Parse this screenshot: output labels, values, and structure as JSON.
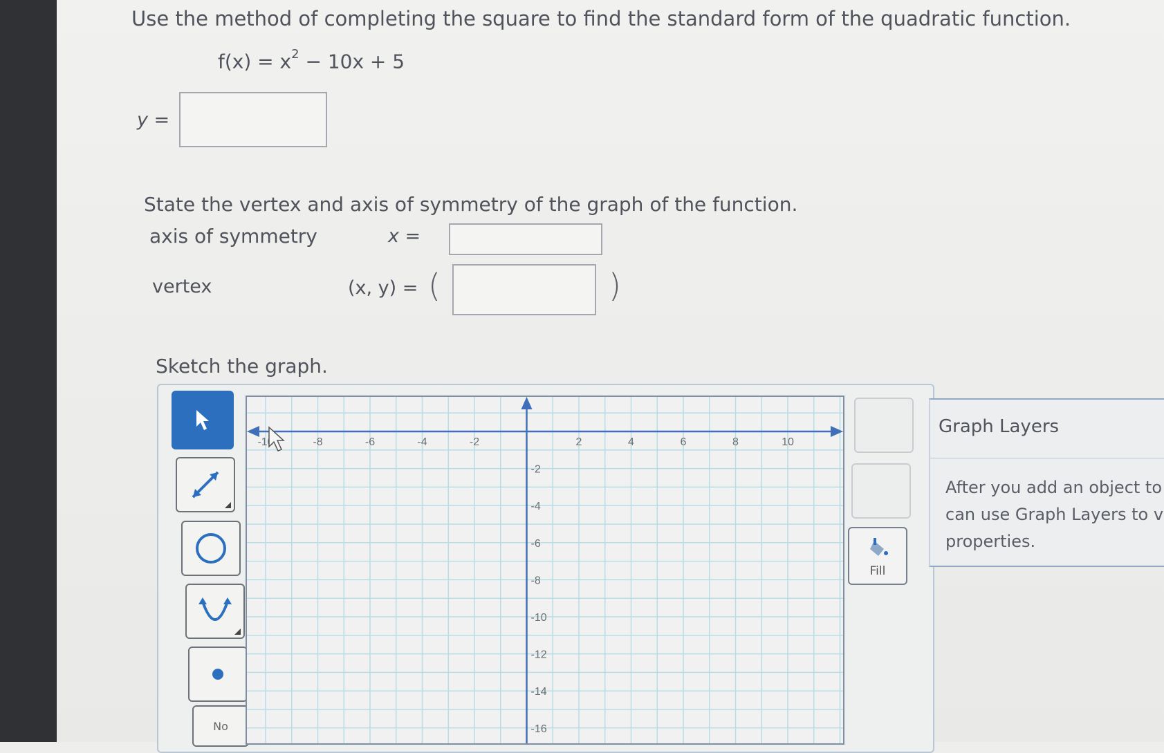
{
  "question": {
    "instruction": "Use the method of completing the square to find the standard form of the quadratic function.",
    "function_text": "f(x) = x",
    "function_exponent": "2",
    "function_rest": " − 10x + 5",
    "y_label": "y =",
    "y_value": "",
    "part2_instruction": "State the vertex and axis of symmetry of the graph of the function.",
    "axis_label": "axis of symmetry",
    "axis_eq_label": "x =",
    "axis_value": "",
    "vertex_label": "vertex",
    "vertex_eq_label": "(x, y) =",
    "vertex_open_paren": "(",
    "vertex_close_paren": ")",
    "vertex_value": "",
    "part3_instruction": "Sketch the graph."
  },
  "toolbar": {
    "tools": [
      {
        "name": "select-tool",
        "icon": "arrow-pointer-icon",
        "active": true
      },
      {
        "name": "line-tool",
        "icon": "line-segment-icon",
        "active": false
      },
      {
        "name": "circle-tool",
        "icon": "circle-icon",
        "active": false
      },
      {
        "name": "parabola-tool",
        "icon": "parabola-icon",
        "active": false
      },
      {
        "name": "point-tool",
        "icon": "point-icon",
        "active": false
      }
    ],
    "no_solution_label": "No"
  },
  "graph": {
    "x_ticks": [
      "-10",
      "-8",
      "-6",
      "-4",
      "-2",
      "2",
      "4",
      "6",
      "8",
      "10"
    ],
    "y_ticks": [
      "-2",
      "-4",
      "-6",
      "-8",
      "-10",
      "-12",
      "-14",
      "-16"
    ],
    "x_range": [
      -10,
      10
    ],
    "y_range": [
      -16,
      0
    ],
    "grid": true
  },
  "side": {
    "fill_label": "Fill",
    "layers_title": "Graph Layers",
    "layers_text": [
      "After you add an object to t",
      "can use Graph Layers to vi",
      "properties."
    ]
  },
  "colors": {
    "accent": "#2c6fbf",
    "grid_line": "#b8dde6",
    "axis": "#3f6fb8"
  }
}
